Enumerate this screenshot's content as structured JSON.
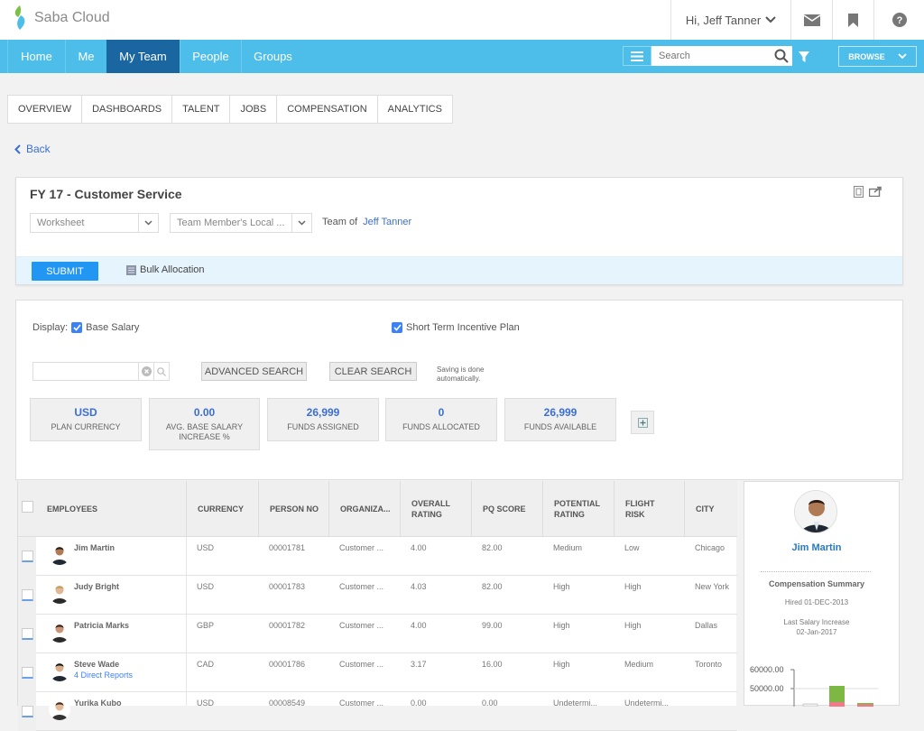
{
  "app": {
    "name": "Saba Cloud"
  },
  "topbar": {
    "greeting": "Hi, Jeff Tanner",
    "icons": [
      "mail-icon",
      "bookmark-icon",
      "help-icon"
    ]
  },
  "nav": {
    "items": [
      {
        "label": "Home",
        "active": false
      },
      {
        "label": "Me",
        "active": false
      },
      {
        "label": "My Team",
        "active": true
      },
      {
        "label": "People",
        "active": false
      },
      {
        "label": "Groups",
        "active": false
      }
    ],
    "search_placeholder": "Search",
    "browse_label": "BROWSE"
  },
  "tabs": [
    "OVERVIEW",
    "DASHBOARDS",
    "TALENT",
    "JOBS",
    "COMPENSATION",
    "ANALYTICS"
  ],
  "back_label": "Back",
  "plan": {
    "title": "FY 17 - Customer Service",
    "view_select": "Worksheet",
    "currency_select": "Team Member's Local ...",
    "team_of_label": "Team of",
    "team_of_name": "Jeff Tanner",
    "submit_label": "SUBMIT",
    "bulk_label": "Bulk Allocation"
  },
  "filters": {
    "display_label": "Display:",
    "base_salary": {
      "label": "Base Salary",
      "checked": true
    },
    "stip": {
      "label": "Short Term Incentive Plan",
      "checked": true
    },
    "search_value": "",
    "advanced_search": "ADVANCED SEARCH",
    "clear_search": "CLEAR SEARCH",
    "saving_note_1": "Saving is done",
    "saving_note_2": "automatically."
  },
  "stats": [
    {
      "value": "USD",
      "label": "PLAN CURRENCY"
    },
    {
      "value": "0.00",
      "label": "AVG. BASE SALARY INCREASE %"
    },
    {
      "value": "26,999",
      "label": "FUNDS ASSIGNED"
    },
    {
      "value": "0",
      "label": "FUNDS ALLOCATED"
    },
    {
      "value": "26,999",
      "label": "FUNDS AVAILABLE"
    }
  ],
  "grid": {
    "headers": [
      "EMPLOYEES",
      "CURRENCY",
      "PERSON NO",
      "ORGANIZA...",
      "OVERALL RATING",
      "PQ SCORE",
      "POTENTIAL RATING",
      "FLIGHT RISK",
      "CITY"
    ],
    "rows": [
      {
        "name": "Jim Martin",
        "sub": "",
        "currency": "USD",
        "person_no": "00001781",
        "org": "Customer ...",
        "overall": "4.00",
        "pq": "82.00",
        "potential": "Medium",
        "flight": "Low",
        "city": "Chicago"
      },
      {
        "name": "Judy Bright",
        "sub": "",
        "currency": "USD",
        "person_no": "00001783",
        "org": "Customer ...",
        "overall": "4.03",
        "pq": "82.00",
        "potential": "High",
        "flight": "High",
        "city": "New York"
      },
      {
        "name": "Patricia Marks",
        "sub": "",
        "currency": "GBP",
        "person_no": "00001782",
        "org": "Customer ...",
        "overall": "4.00",
        "pq": "99.00",
        "potential": "High",
        "flight": "High",
        "city": "Dallas"
      },
      {
        "name": "Steve Wade",
        "sub": "4 Direct Reports",
        "currency": "CAD",
        "person_no": "00001786",
        "org": "Customer ...",
        "overall": "3.17",
        "pq": "16.00",
        "potential": "High",
        "flight": "Medium",
        "city": "Toronto"
      },
      {
        "name": "Yurika Kubo",
        "sub": "",
        "currency": "USD",
        "person_no": "00008549",
        "org": "Customer ...",
        "overall": "0.00",
        "pq": "0.00",
        "potential": "Undetermi...",
        "flight": "Undetermi...",
        "city": ""
      }
    ]
  },
  "side": {
    "name": "Jim Martin",
    "title": "Compensation Summary",
    "hired": "Hired 01-DEC-2013",
    "last_increase_label": "Last Salary Increase",
    "last_increase_date": "02-Jan-2017",
    "chart_ticks": [
      "60000.00",
      "50000.00"
    ]
  },
  "colors": {
    "accent": "#4dbdea",
    "active_nav": "#1a66a0",
    "link": "#3b6fd1",
    "submit": "#2196f3"
  }
}
